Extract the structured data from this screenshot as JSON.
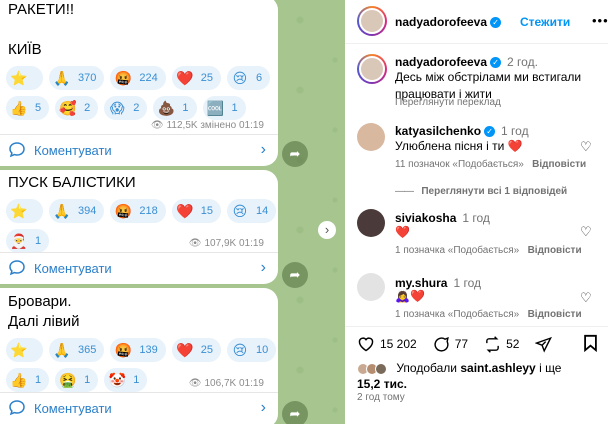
{
  "telegram": {
    "messages": [
      {
        "text_lines": [
          "РАКЕТИ!!",
          "",
          "КИЇВ"
        ],
        "reactions": [
          {
            "icon": "star-emoji",
            "glyph": "⭐",
            "count": "",
            "selected": false
          },
          {
            "icon": "pray-emoji",
            "glyph": "🙏",
            "count": "370",
            "selected": false
          },
          {
            "icon": "angry-face-emoji",
            "glyph": "🤬",
            "count": "224",
            "selected": false
          },
          {
            "icon": "red-heart-emoji",
            "glyph": "❤️",
            "count": "25",
            "selected": false
          },
          {
            "icon": "crying-face-emoji",
            "glyph": "😢",
            "count": "6",
            "selected": false
          },
          {
            "icon": "thumbs-up-emoji",
            "glyph": "👍",
            "count": "5",
            "selected": false
          },
          {
            "icon": "heart-face-emoji",
            "glyph": "🥰",
            "count": "2",
            "selected": false
          },
          {
            "icon": "screaming-face-emoji",
            "glyph": "😱",
            "count": "2",
            "selected": false
          },
          {
            "icon": "poop-emoji",
            "glyph": "💩",
            "count": "1",
            "selected": false
          },
          {
            "icon": "cool-emoji",
            "glyph": "🆒",
            "count": "1",
            "selected": false
          }
        ],
        "meta": "112,5K змінено 01:19",
        "comment_label": "Коментувати"
      },
      {
        "text_lines": [
          "ПУСК БАЛІСТИКИ"
        ],
        "reactions": [
          {
            "icon": "star-emoji",
            "glyph": "⭐",
            "count": "",
            "selected": false
          },
          {
            "icon": "pray-emoji",
            "glyph": "🙏",
            "count": "394",
            "selected": false
          },
          {
            "icon": "angry-face-emoji",
            "glyph": "🤬",
            "count": "218",
            "selected": false
          },
          {
            "icon": "red-heart-emoji",
            "glyph": "❤️",
            "count": "15",
            "selected": false
          },
          {
            "icon": "crying-face-emoji",
            "glyph": "😢",
            "count": "14",
            "selected": false
          },
          {
            "icon": "santa-emoji",
            "glyph": "🎅",
            "count": "1",
            "selected": false
          }
        ],
        "meta": "107,9K 01:19",
        "comment_label": "Коментувати"
      },
      {
        "text_lines": [
          "Бровари.",
          "Далі лівий"
        ],
        "reactions": [
          {
            "icon": "star-emoji",
            "glyph": "⭐",
            "count": "",
            "selected": false
          },
          {
            "icon": "pray-emoji",
            "glyph": "🙏",
            "count": "365",
            "selected": false
          },
          {
            "icon": "angry-face-emoji",
            "glyph": "🤬",
            "count": "139",
            "selected": false
          },
          {
            "icon": "red-heart-emoji",
            "glyph": "❤️",
            "count": "25",
            "selected": false
          },
          {
            "icon": "crying-face-emoji",
            "glyph": "😢",
            "count": "10",
            "selected": false
          },
          {
            "icon": "thumbs-up-emoji",
            "glyph": "👍",
            "count": "1",
            "selected": false
          },
          {
            "icon": "nauseated-face-emoji",
            "glyph": "🤮",
            "count": "1",
            "selected": false
          },
          {
            "icon": "clown-face-emoji",
            "glyph": "🤡",
            "count": "1",
            "selected": false
          }
        ],
        "meta": "106,7K 01:19",
        "comment_label": "Коментувати"
      }
    ]
  },
  "instagram": {
    "header": {
      "username": "nadyadorofeeva",
      "follow_label": "Стежити",
      "more_label": "•••"
    },
    "caption": {
      "username": "nadyadorofeeva",
      "time": "2 год.",
      "text": "Десь між обстрілами ми встигали працювати і жити",
      "translate_label": "Переглянути переклад"
    },
    "comments": [
      {
        "username": "katyasilchenko",
        "verified": true,
        "time": "1 год",
        "text": "Улюблена пісня і ти",
        "emoji": "❤️",
        "likes": "11 позначок «Подобається»",
        "reply_label": "Відповісти",
        "replies_label": "Переглянути всі 1 відповідей"
      },
      {
        "username": "siviakosha",
        "verified": false,
        "time": "1 год",
        "text": "",
        "emoji": "❤️",
        "likes": "1 позначка «Подобається»",
        "reply_label": "Відповісти"
      },
      {
        "username": "my.shura",
        "verified": false,
        "time": "1 год",
        "text": "",
        "emoji": "🙇‍♀️❤️",
        "likes": "1 позначка «Подобається»",
        "reply_label": "Відповісти"
      }
    ],
    "actions": {
      "likes_count": "15 202",
      "comments_count": "77",
      "reposts_count": "52"
    },
    "liked_by": {
      "prefix": "Уподобали",
      "user": "saint.ashleyy",
      "suffix": "і ще",
      "count": "15,2 тис."
    },
    "post_time": "2 год тому"
  },
  "colors": {
    "telegram_bg": "#a6c58f",
    "reaction_chip": "#e7f2fb",
    "link_blue": "#2c80c9",
    "instagram_blue": "#0095f6"
  }
}
